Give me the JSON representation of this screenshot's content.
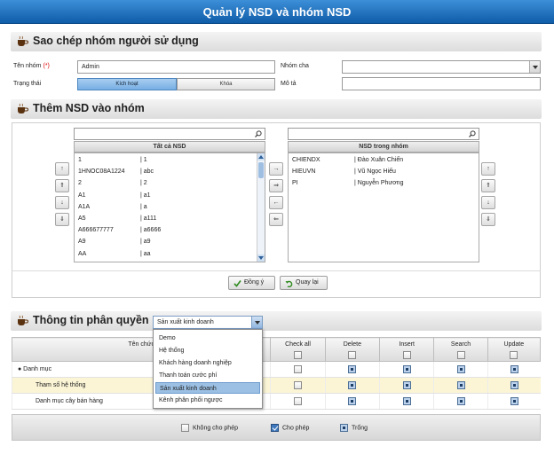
{
  "window": {
    "title": "Quản lý NSD và nhóm NSD"
  },
  "section1": {
    "title": "Sao chép nhóm người sử dụng",
    "group_name_label": "Tên nhóm",
    "required_mark": "(*)",
    "group_name_value": "Admin",
    "parent_group_label": "Nhóm cha",
    "parent_group_value": "",
    "status_label": "Trạng thái",
    "status_active": "Kích hoạt",
    "status_locked": "Khóa",
    "description_label": "Mô tả",
    "description_value": ""
  },
  "section2": {
    "title": "Thêm NSD vào nhóm",
    "all_users_header": "Tất cả NSD",
    "group_users_header": "NSD trong nhóm",
    "all_users": [
      {
        "code": "1",
        "name": "| 1"
      },
      {
        "code": "1HNOC08A1224",
        "name": "| abc"
      },
      {
        "code": "2",
        "name": "| 2"
      },
      {
        "code": "A1",
        "name": "| a1"
      },
      {
        "code": "A1A",
        "name": "| a"
      },
      {
        "code": "A5",
        "name": "| a111"
      },
      {
        "code": "A666677777",
        "name": "| a6666"
      },
      {
        "code": "A9",
        "name": "| a9"
      },
      {
        "code": "AA",
        "name": "| aa"
      }
    ],
    "group_users": [
      {
        "code": "CHIENDX",
        "name": "| Đào Xuân Chiến"
      },
      {
        "code": "HIEUVN",
        "name": "| Vũ Ngọc Hiếu"
      },
      {
        "code": "PI",
        "name": "| Nguyễn Phương"
      }
    ],
    "sort_left": [
      "↑",
      "⇑",
      "↓",
      "⇓"
    ],
    "move_buttons": [
      "→",
      "⇒",
      "←",
      "⇐"
    ],
    "sort_right": [
      "↑",
      "⇑",
      "↓",
      "⇓"
    ],
    "ok_label": "Đồng ý",
    "back_label": "Quay lại"
  },
  "section3": {
    "title": "Thông tin phân quyền",
    "selected_system": "Sản xuất kinh doanh",
    "systems": [
      "Demo",
      "Hệ thống",
      "Khách hàng doanh nghiệp",
      "Thanh toán cước phí",
      "Sản xuất kinh doanh",
      "Kênh phân phối ngược"
    ],
    "columns": {
      "function": "Tên chức",
      "check_all": "Check all",
      "delete": "Delete",
      "insert": "Insert",
      "search": "Search",
      "update": "Update"
    },
    "rows": [
      {
        "name": "● Danh mục",
        "state": "tri",
        "selected": false
      },
      {
        "name": "Tham số hệ thống",
        "state": "tri",
        "selected": true
      },
      {
        "name": "Danh mục cây bán hàng",
        "state": "tri",
        "selected": false
      }
    ],
    "legend": {
      "deny": "Không cho phép",
      "allow": "Cho phép",
      "empty": "Trống"
    }
  }
}
